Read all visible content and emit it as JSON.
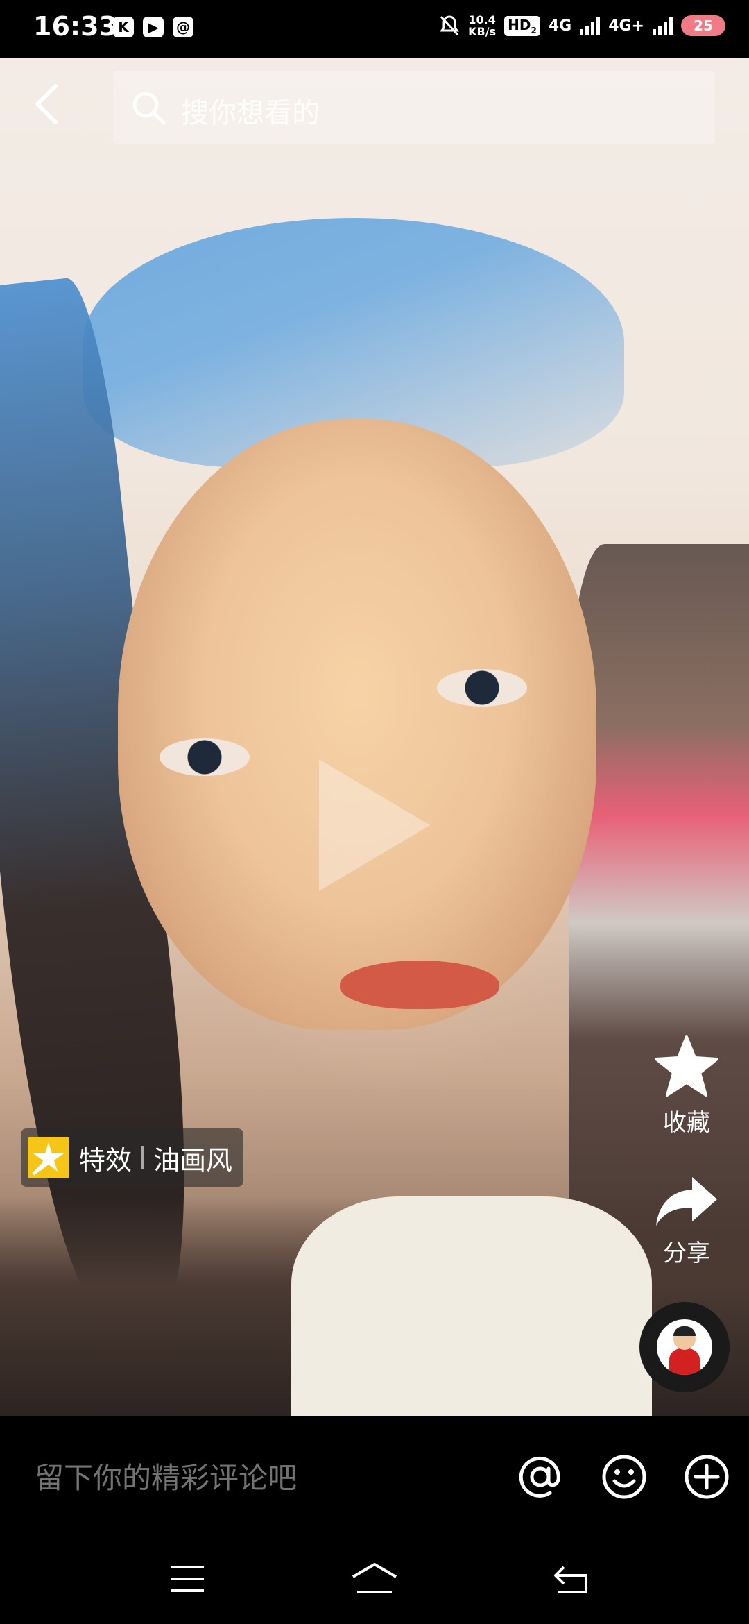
{
  "status_bar": {
    "time": "16:33",
    "app_icons": [
      "K",
      "▶",
      "@"
    ],
    "net_speed_value": "10.4",
    "net_speed_unit": "KB/s",
    "hd_label": "HD",
    "hd_sub": "2",
    "signal1_label": "4G",
    "signal2_label": "4G+",
    "battery": "25"
  },
  "search": {
    "placeholder": "搜你想看的"
  },
  "effect": {
    "label": "特效",
    "name": "油画风"
  },
  "actions": {
    "favorite_label": "收藏",
    "share_label": "分享"
  },
  "comment": {
    "placeholder": "留下你的精彩评论吧"
  },
  "colors": {
    "accent_effect": "#f5c518",
    "battery": "#f07a86"
  }
}
